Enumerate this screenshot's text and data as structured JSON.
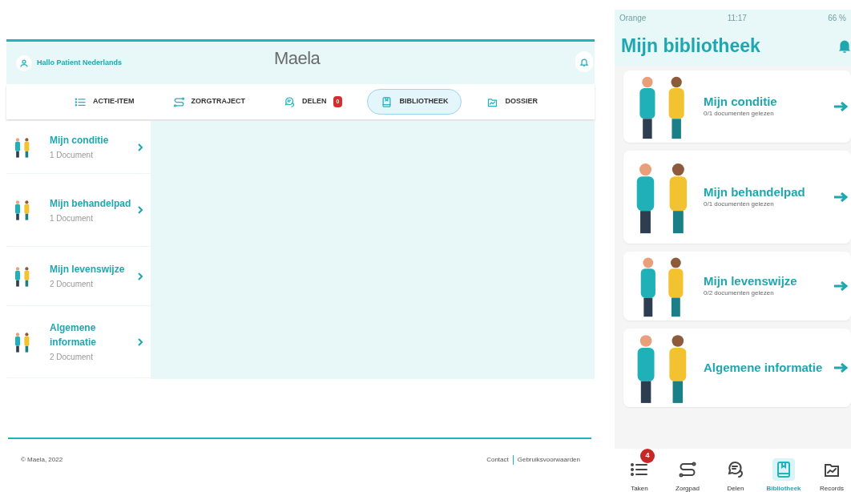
{
  "desktop": {
    "header": {
      "greeting": "Hallo Patient Nederlands",
      "logo": "Maela"
    },
    "nav_tabs": [
      {
        "kind": "list",
        "label": "ACTIE-ITEM",
        "selected": false
      },
      {
        "kind": "route",
        "label": "ZORGTRAJECT",
        "selected": false
      },
      {
        "kind": "chat",
        "label": "DELEN",
        "selected": false,
        "badge": "0"
      },
      {
        "kind": "book",
        "label": "BIBLIOTHEEK",
        "selected": true
      },
      {
        "kind": "folder",
        "label": "DOSSIER",
        "selected": false
      }
    ],
    "sidebar": {
      "items": [
        {
          "title": "Mijn conditie",
          "subtitle": "1 Document"
        },
        {
          "title": "Mijn behandelpad",
          "subtitle": "1 Document"
        },
        {
          "title": "Mijn levenswijze",
          "subtitle": "2 Document"
        },
        {
          "title": "Algemene informatie",
          "subtitle": "2 Document"
        }
      ]
    },
    "footer": {
      "copyright": "© Maela, 2022",
      "links": [
        "Contact",
        "Gebruiksvoorwaarden"
      ]
    }
  },
  "phone": {
    "status_bar": {
      "carrier": "Orange",
      "time": "11:17",
      "battery": "66 %"
    },
    "title": "Mijn bibliotheek",
    "cards": [
      {
        "title": "Mijn conditie",
        "subtitle": "0/1 documenten gelezen"
      },
      {
        "title": "Mijn behandelpad",
        "subtitle": "0/1 documenten gelezen"
      },
      {
        "title": "Mijn levenswijze",
        "subtitle": "0/2 documenten gelezen"
      },
      {
        "title": "Algemene informatie"
      }
    ],
    "tab_bar": [
      {
        "kind": "list",
        "label": "Taken",
        "selected": false,
        "badge": "4"
      },
      {
        "kind": "route",
        "label": "Zorgpad",
        "selected": false
      },
      {
        "kind": "chat",
        "label": "Delen",
        "selected": false
      },
      {
        "kind": "book",
        "label": "Bibliotheek",
        "selected": true
      },
      {
        "kind": "folder",
        "label": "Records",
        "selected": false
      }
    ]
  }
}
